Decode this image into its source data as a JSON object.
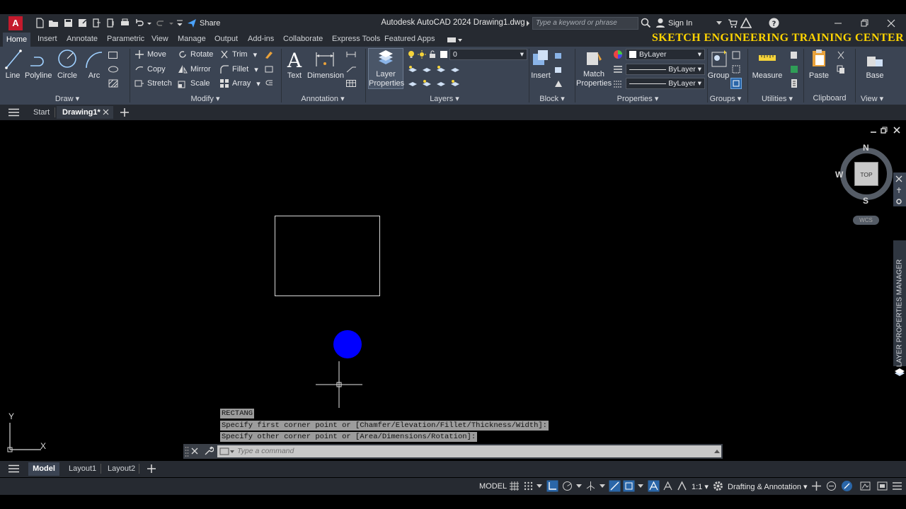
{
  "app": {
    "logo_letter": "A",
    "title": "Autodesk AutoCAD 2024   Drawing1.dwg",
    "share_label": "Share",
    "search_placeholder": "Type a keyword or phrase",
    "sign_in": "Sign In"
  },
  "ribbon_tabs": [
    "Home",
    "Insert",
    "Annotate",
    "Parametric",
    "View",
    "Manage",
    "Output",
    "Add-ins",
    "Collaborate",
    "Express Tools",
    "Featured Apps"
  ],
  "banner": "SKETCH ENGINEERING TRAINING CENTER",
  "draw": {
    "label": "Draw",
    "line": "Line",
    "polyline": "Polyline",
    "circle": "Circle",
    "arc": "Arc"
  },
  "modify": {
    "label": "Modify",
    "move": "Move",
    "rotate": "Rotate",
    "trim": "Trim",
    "copy": "Copy",
    "mirror": "Mirror",
    "fillet": "Fillet",
    "stretch": "Stretch",
    "scale": "Scale",
    "array": "Array"
  },
  "annotation": {
    "label": "Annotation",
    "text": "Text",
    "dimension": "Dimension"
  },
  "layers": {
    "label": "Layers",
    "layer_properties": "Layer Properties",
    "current_layer": "0"
  },
  "block": {
    "label": "Block",
    "insert": "Insert"
  },
  "properties": {
    "label": "Properties",
    "match": "Match Properties",
    "color": "ByLayer",
    "linetype": "ByLayer",
    "lineweight": "ByLayer"
  },
  "groups": {
    "label": "Groups",
    "group": "Group"
  },
  "utilities": {
    "label": "Utilities",
    "measure": "Measure"
  },
  "clipboard": {
    "label": "Clipboard",
    "paste": "Paste"
  },
  "view": {
    "label": "View",
    "base": "Base"
  },
  "file_tabs": {
    "start": "Start",
    "drawing": "Drawing1*"
  },
  "viewcube": {
    "n": "N",
    "s": "S",
    "w": "W",
    "top": "TOP",
    "wcs": "WCS"
  },
  "side_palette": "LAYER PROPERTIES MANAGER",
  "ucs": {
    "x": "X",
    "y": "Y"
  },
  "command": {
    "history": [
      "RECTANG",
      "Specify first corner point or [Chamfer/Elevation/Fillet/Thickness/Width]:",
      "Specify other corner point or [Area/Dimensions/Rotation]:"
    ],
    "placeholder": "Type a command"
  },
  "layout_tabs": [
    "Model",
    "Layout1",
    "Layout2"
  ],
  "status": {
    "model": "MODEL",
    "scale": "1:1",
    "workspace": "Drafting & Annotation"
  },
  "colors": {
    "accent": "#3b4453",
    "circle_fill": "#0000ff",
    "banner": "#ffd400"
  }
}
